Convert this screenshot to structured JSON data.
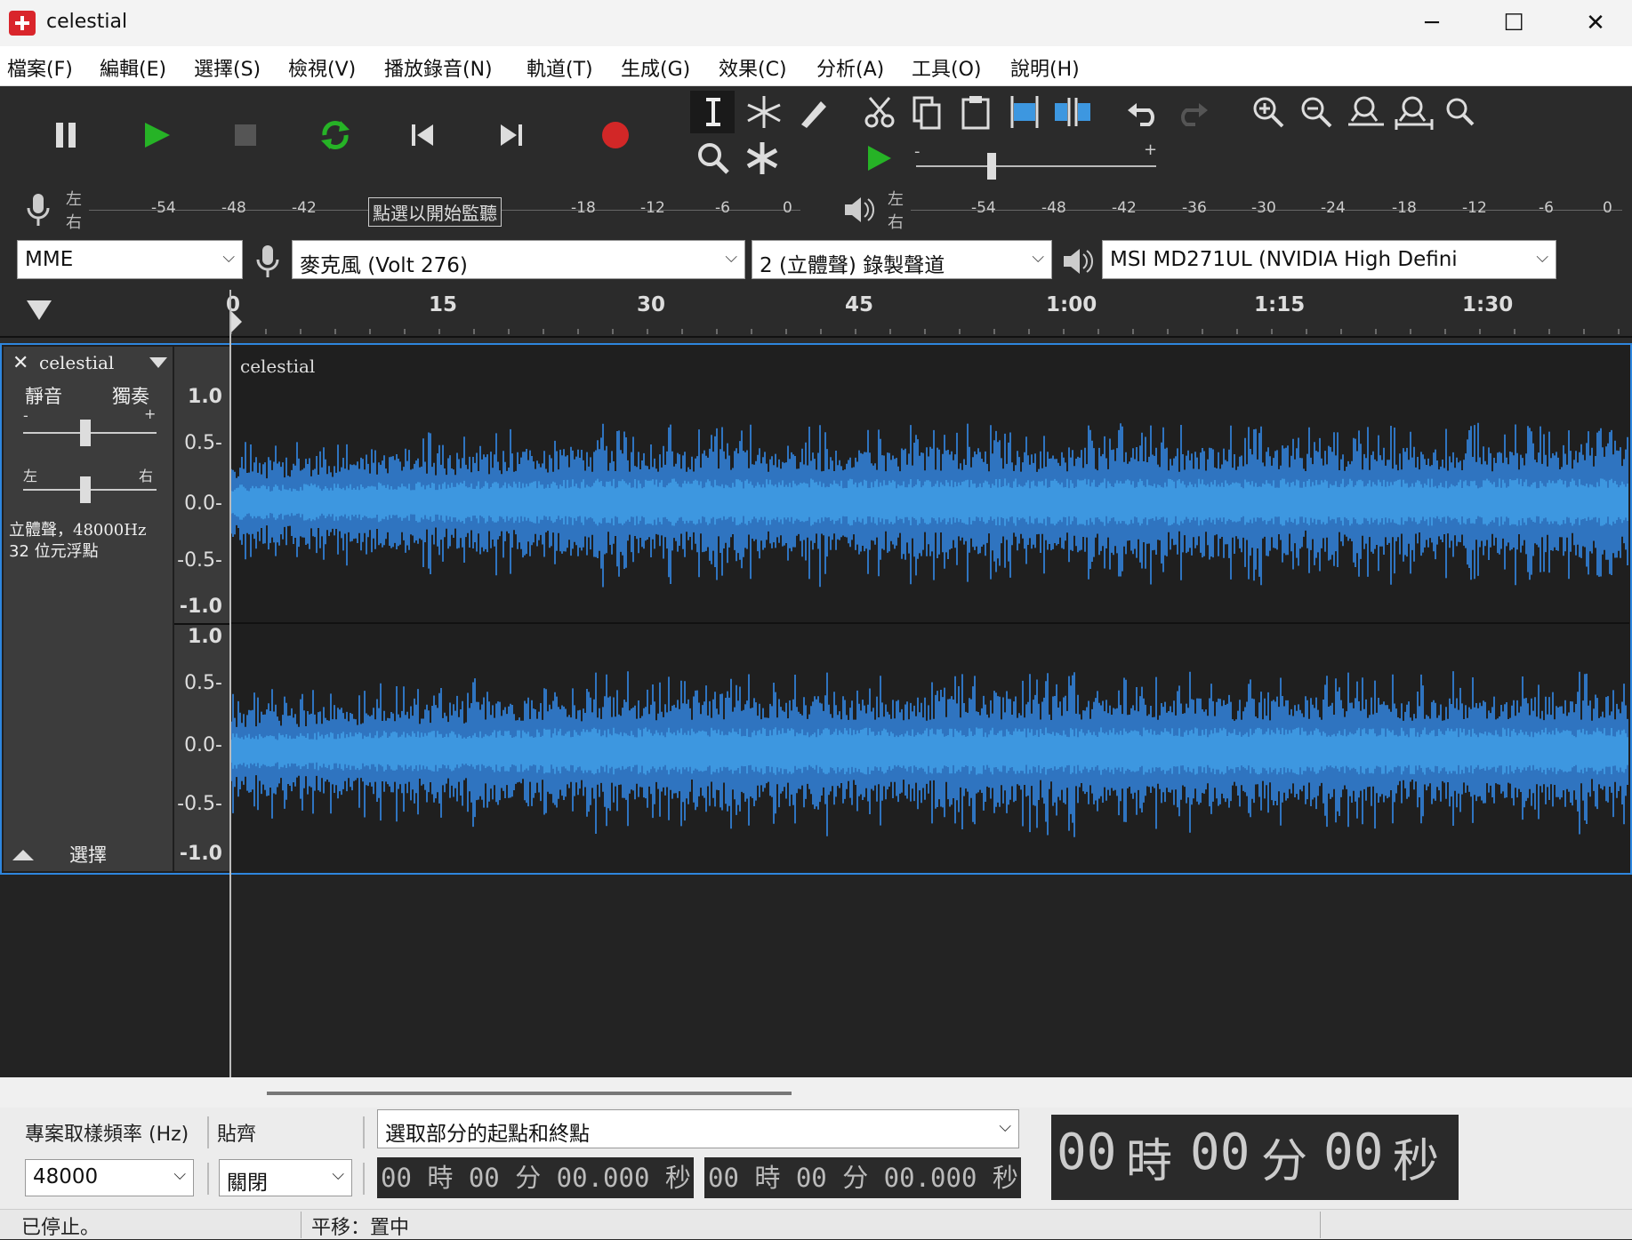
{
  "window": {
    "title": "celestial",
    "minimize": "─",
    "maximize": "☐",
    "close": "✕"
  },
  "menu": [
    "檔案(F)",
    "編輯(E)",
    "選擇(S)",
    "檢視(V)",
    "播放錄音(N)",
    "軌道(T)",
    "生成(G)",
    "效果(C)",
    "分析(A)",
    "工具(O)",
    "說明(H)"
  ],
  "meters": {
    "record": {
      "left": "左",
      "right": "右",
      "ticks": [
        "-54",
        "-48",
        "-42",
        "-18",
        "-12",
        "-6",
        "0"
      ],
      "tooltip": "點選以開始監聽"
    },
    "play": {
      "left": "左",
      "right": "右",
      "ticks": [
        "-54",
        "-48",
        "-42",
        "-36",
        "-30",
        "-24",
        "-18",
        "-12",
        "-6",
        "0"
      ]
    },
    "speed_min": "-",
    "speed_max": "+"
  },
  "devices": {
    "host": "MME",
    "input": "麥克風 (Volt 276)",
    "channels": "2 (立體聲) 錄製聲道",
    "output": "MSI MD271UL (NVIDIA High Defini"
  },
  "ruler": {
    "ticks": [
      "0",
      "15",
      "30",
      "45",
      "1:00",
      "1:15",
      "1:30"
    ]
  },
  "track": {
    "name": "celestial",
    "mute": "靜音",
    "solo": "獨奏",
    "gain_min": "-",
    "gain_max": "+",
    "pan_left": "左",
    "pan_right": "右",
    "info_line1": "立體聲，48000Hz",
    "info_line2": "32 位元浮點",
    "select": "選擇",
    "clip_name": "celestial",
    "y_labels": [
      "1.0",
      "0.5-",
      "0.0-",
      "-0.5-",
      "-1.0"
    ]
  },
  "selection": {
    "rate_label": "專案取樣頻率 (Hz)",
    "rate_value": "48000",
    "snap_label": "貼齊",
    "snap_value": "關閉",
    "mode": "選取部分的起點和終點",
    "start_time": "00 時 00 分 00.000 秒",
    "end_time": "00 時 00 分 00.000 秒",
    "big_time_h": "00",
    "big_time_h_unit": "時",
    "big_time_m": "00",
    "big_time_m_unit": "分",
    "big_time_s": "00",
    "big_time_s_unit": "秒"
  },
  "status": {
    "left": "已停止。",
    "right": "平移：置中"
  },
  "colors": {
    "wave_outer": "#2f74c0",
    "wave_inner": "#3d97e0",
    "accent": "#2e86de",
    "play": "#26b326",
    "record": "#d22727"
  }
}
